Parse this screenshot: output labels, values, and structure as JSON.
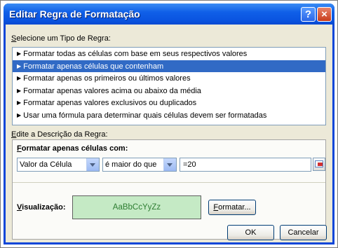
{
  "dialog": {
    "title": "Editar Regra de Formatação",
    "help_glyph": "?",
    "close_glyph": "×"
  },
  "rule_type": {
    "label": "Selecione um Tipo de Regra:",
    "items": [
      "Formatar todas as células com base em seus respectivos valores",
      "Formatar apenas células que contenham",
      "Formatar apenas os primeiros ou últimos valores",
      "Formatar apenas valores acima ou abaixo da média",
      "Formatar apenas valores exclusivos ou duplicados",
      "Usar uma fórmula para determinar quais células devem ser formatadas"
    ],
    "selected_index": 1
  },
  "description": {
    "label": "Edite a Descrição da Regra:",
    "heading": "Formatar apenas células com:",
    "condition_field": "Valor da Célula",
    "operator": "é maior do que",
    "value": "=20"
  },
  "preview": {
    "label": "Visualização:",
    "sample": "AaBbCcYyZz",
    "format_button": "Formatar..."
  },
  "buttons": {
    "ok": "OK",
    "cancel": "Cancelar"
  },
  "colors": {
    "selection": "#316ac5",
    "preview_fill": "#c5eac5",
    "preview_text": "#2e7d32",
    "titlebar": "#0a54e0"
  }
}
